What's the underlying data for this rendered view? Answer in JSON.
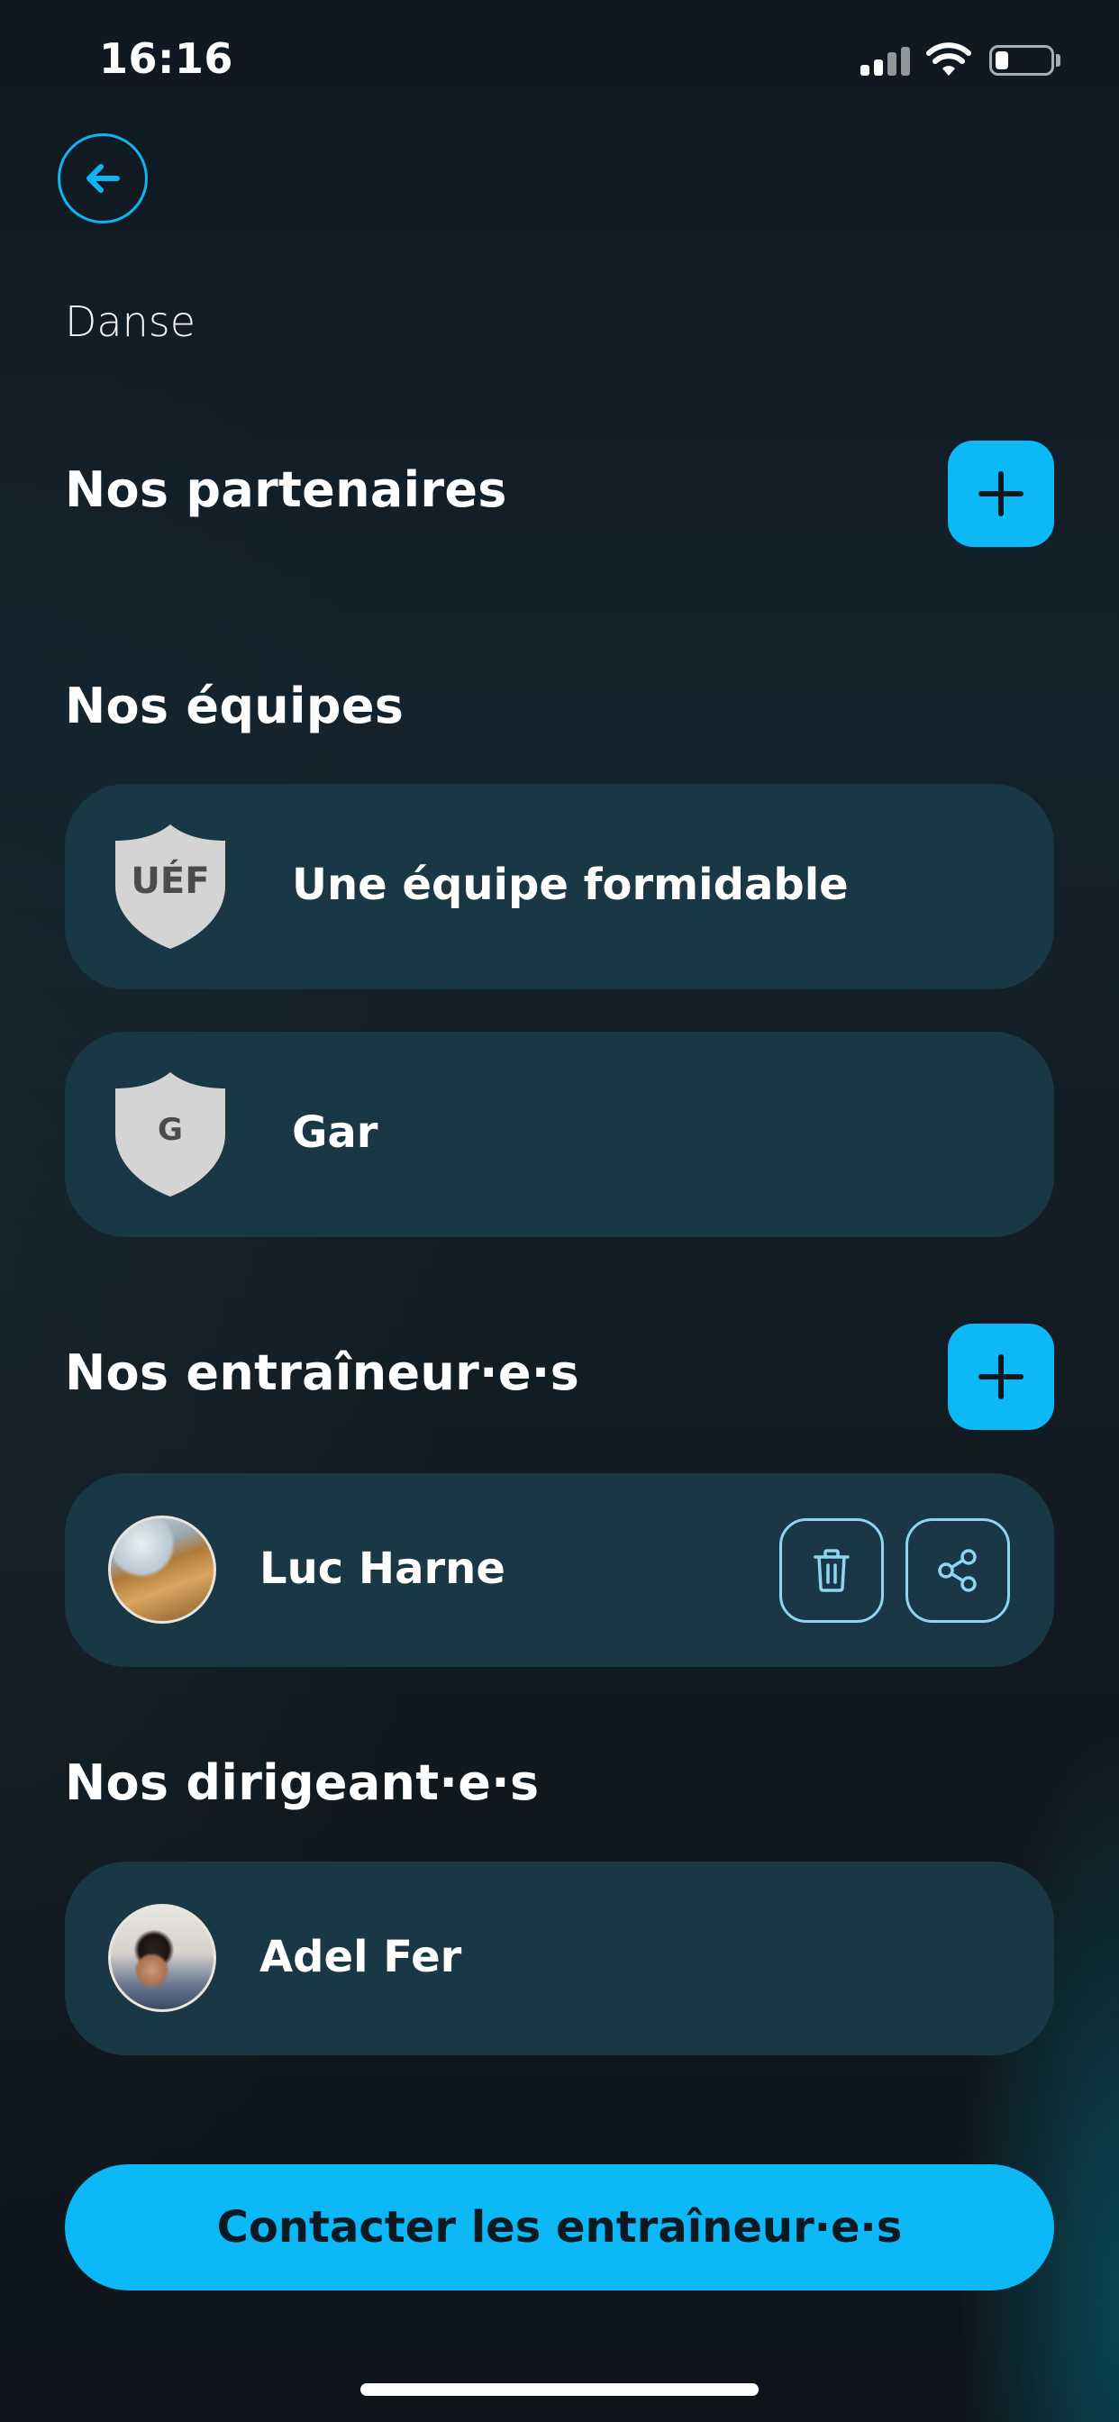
{
  "status_bar": {
    "time": "16:16"
  },
  "header": {
    "breadcrumb": "Danse"
  },
  "sections": {
    "partners": {
      "title": "Nos partenaires"
    },
    "teams": {
      "title": "Nos équipes",
      "items": [
        {
          "initials": "UÉF",
          "name": "Une équipe formidable"
        },
        {
          "initials": "G",
          "name": "Gar"
        }
      ]
    },
    "coaches": {
      "title": "Nos entraîneur·e·s",
      "items": [
        {
          "name": "Luc Harne"
        }
      ]
    },
    "leaders": {
      "title": "Nos dirigeant·e·s",
      "items": [
        {
          "name": "Adel Fer"
        }
      ]
    }
  },
  "cta": {
    "label": "Contacter les entraîneur·e·s"
  },
  "colors": {
    "accent": "#0db8f6",
    "card": "#1a3746",
    "background": "#111a21",
    "shield": "#d4d4d4"
  },
  "icons": [
    "back-arrow-icon",
    "plus-icon",
    "shield-icon",
    "trash-icon",
    "share-icon",
    "cellular-signal-icon",
    "wifi-icon",
    "battery-icon"
  ]
}
